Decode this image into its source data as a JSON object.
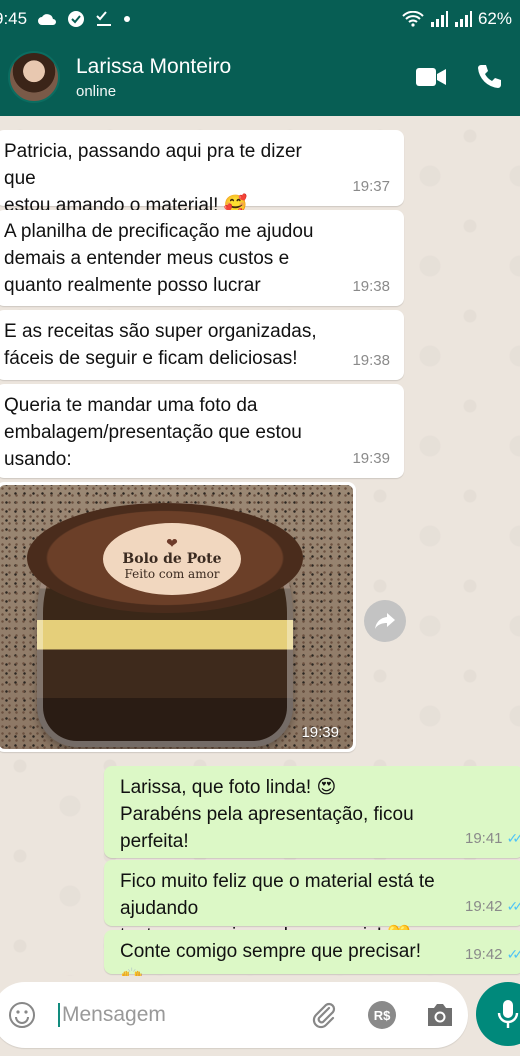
{
  "status_bar": {
    "time": "9:45",
    "battery": "62%",
    "icons": [
      "cloud-icon",
      "check-circle-icon",
      "checklist-icon",
      "dot-icon",
      "wifi-icon",
      "signal-icon",
      "signal-icon"
    ]
  },
  "header": {
    "contact_name": "Larissa Monteiro",
    "contact_status": "online",
    "icons": [
      "video-call-icon",
      "phone-icon"
    ],
    "color": "#075e54"
  },
  "messages": [
    {
      "direction": "in",
      "text": "Patricia, passando aqui pra te dizer que\nestou amando o material! 🥰",
      "time": "19:37"
    },
    {
      "direction": "in",
      "text": "A planilha de precificação me ajudou\ndemais a entender meus custos e\nquanto realmente posso lucrar",
      "time": "19:38"
    },
    {
      "direction": "in",
      "text": "E as receitas são super organizadas,\nfáceis de seguir e ficam deliciosas!",
      "time": "19:38"
    },
    {
      "direction": "in",
      "text": "Queria te mandar uma foto da\nembalagem/presentação que estou\nusando:",
      "time": "19:39"
    },
    {
      "direction": "out",
      "text": "Larissa, que foto linda! 😍\nParabéns pela apresentação, ficou perfeita!",
      "time": "19:41"
    },
    {
      "direction": "out",
      "text": "Fico muito feliz que o material está te ajudando\ntanto a organizar e lucrar mais! 💛",
      "time": "19:42"
    },
    {
      "direction": "out",
      "text": "Conte comigo sempre que precisar! 🙌",
      "time": "19:42"
    }
  ],
  "photo_message": {
    "time": "19:39",
    "sticker_line1": "Bolo de Pote",
    "sticker_line2": "Feito com amor"
  },
  "input": {
    "placeholder": "Mensagem",
    "icons": [
      "emoji-icon",
      "attach-icon",
      "payment-icon",
      "camera-icon",
      "mic-icon"
    ],
    "payment_label": "R$"
  },
  "colors": {
    "incoming_bubble": "#ffffff",
    "outgoing_bubble": "#dcf8c6",
    "chat_background": "#ece5dd",
    "read_ticks": "#4fc3f7",
    "mic_button": "#00897b"
  }
}
